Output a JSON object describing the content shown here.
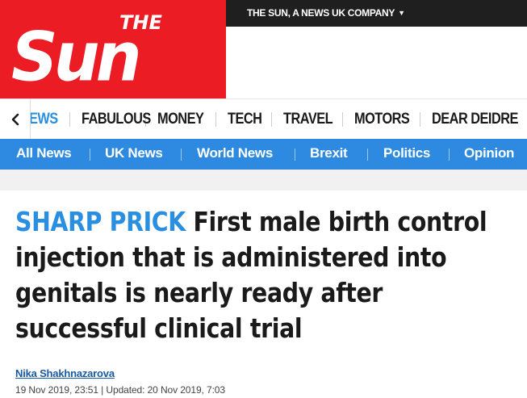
{
  "brand": {
    "logo_the": "THE",
    "logo_sun": "Sun",
    "logo_color": "#eb1c24",
    "company_link": "THE SUN, A NEWS UK COMPANY"
  },
  "section_nav": {
    "back_icon": "chevron-left-icon",
    "items": [
      {
        "label": "EWS",
        "active": true
      },
      {
        "label": "FABULOUS"
      },
      {
        "label": "MONEY"
      },
      {
        "label": "TECH"
      },
      {
        "label": "TRAVEL"
      },
      {
        "label": "MOTORS"
      },
      {
        "label": "DEAR DEIDRE"
      }
    ]
  },
  "category_bar": {
    "color": "#2e8ae0",
    "items": [
      "All News",
      "UK News",
      "World News",
      "Brexit",
      "Politics",
      "Opinion"
    ]
  },
  "article": {
    "kicker": "SHARP PRICK",
    "headline": "First male birth control injection that is administered into genitals is nearly ready after successful clinical trial",
    "author": "Nika Shakhnazarova",
    "dates": "19 Nov 2019, 23:51 | Updated: 20 Nov 2019, 7:03",
    "accent_color": "#2a8fe0"
  }
}
